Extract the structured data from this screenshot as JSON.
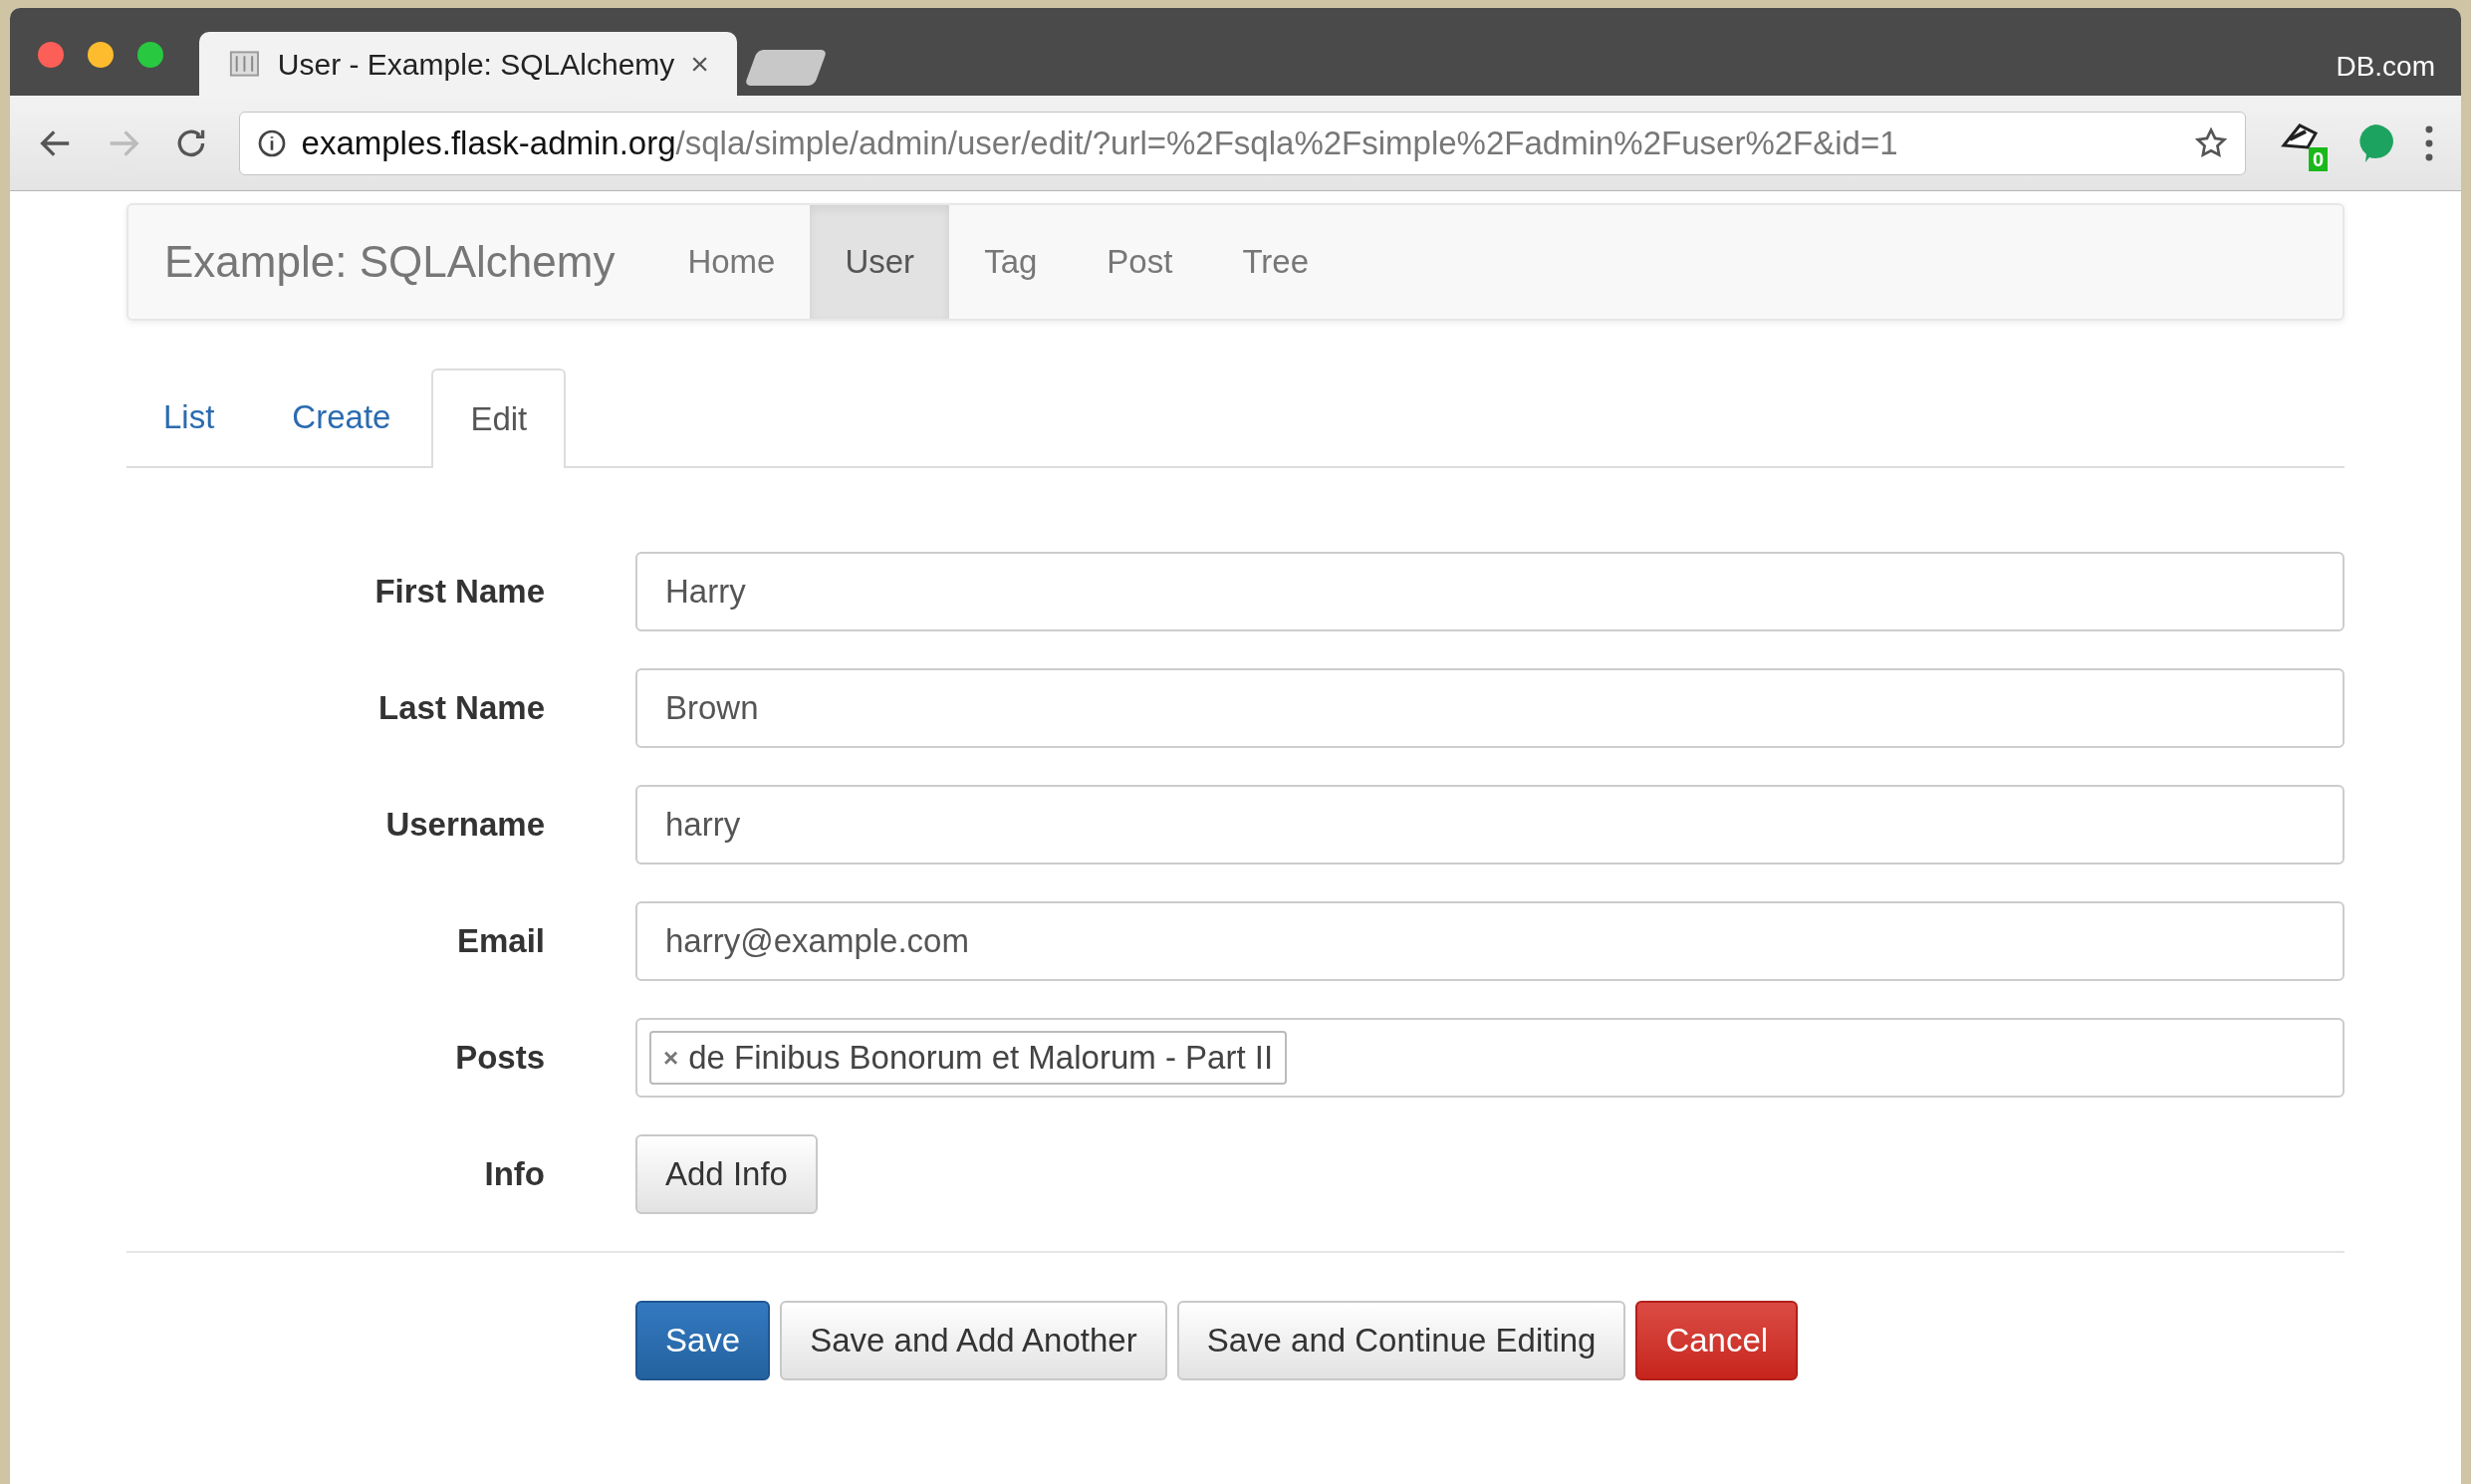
{
  "browser": {
    "tab_title": "User - Example: SQLAlchemy",
    "tab_close": "×",
    "profile": "DB.com",
    "url_host": "examples.flask-admin.org",
    "url_path": "/sqla/simple/admin/user/edit/?url=%2Fsqla%2Fsimple%2Fadmin%2Fuser%2F&id=1",
    "extension_badge": "0"
  },
  "navbar": {
    "brand": "Example: SQLAlchemy",
    "items": [
      {
        "label": "Home",
        "selected": false
      },
      {
        "label": "User",
        "selected": true
      },
      {
        "label": "Tag",
        "selected": false
      },
      {
        "label": "Post",
        "selected": false
      },
      {
        "label": "Tree",
        "selected": false
      }
    ]
  },
  "tabs": [
    {
      "label": "List",
      "selected": false
    },
    {
      "label": "Create",
      "selected": false
    },
    {
      "label": "Edit",
      "selected": true
    }
  ],
  "fields": [
    {
      "label": "First Name",
      "kind": "text",
      "value": "Harry"
    },
    {
      "label": "Last Name",
      "kind": "text",
      "value": "Brown"
    },
    {
      "label": "Username",
      "kind": "text",
      "value": "harry"
    },
    {
      "label": "Email",
      "kind": "text",
      "value": "harry@example.com"
    },
    {
      "label": "Posts",
      "kind": "tags",
      "tags": [
        {
          "remove": "×",
          "label": "de Finibus Bonorum et Malorum - Part II"
        }
      ]
    },
    {
      "label": "Info",
      "kind": "button",
      "button": "Add Info"
    }
  ],
  "actions": [
    {
      "label": "Save",
      "kind": "primary"
    },
    {
      "label": "Save and Add Another",
      "kind": "default"
    },
    {
      "label": "Save and Continue Editing",
      "kind": "default"
    },
    {
      "label": "Cancel",
      "kind": "danger"
    }
  ]
}
